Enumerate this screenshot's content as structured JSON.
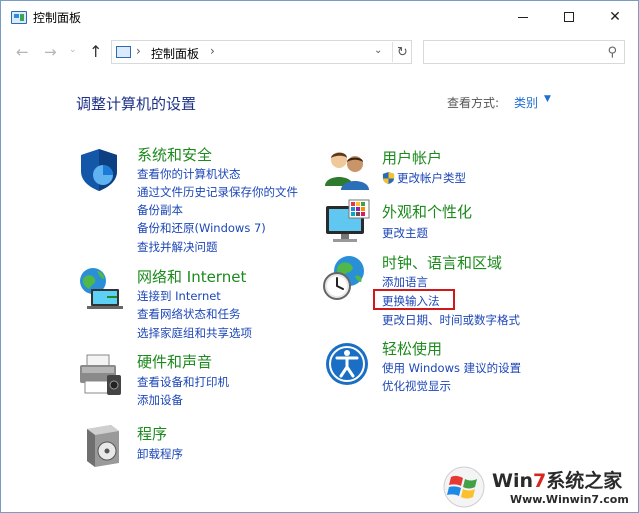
{
  "window": {
    "title": "控制面板",
    "minimize_icon": "minimize-icon",
    "maximize_icon": "maximize-icon",
    "close_glyph": "✕"
  },
  "nav": {
    "back_glyph": "←",
    "forward_glyph": "→",
    "recent_glyph": "⌄",
    "up_glyph": "↑",
    "address_sep": "›",
    "address_text": "控制面板",
    "address_sep2": "›",
    "address_dropdown": "⌄",
    "refresh_glyph": "↻",
    "search_placeholder": "",
    "search_glyph": "⚲"
  },
  "header": {
    "title": "调整计算机的设置",
    "view_label": "查看方式:",
    "view_value": "类别",
    "view_caret": "▼"
  },
  "categories": {
    "system": {
      "title": "系统和安全",
      "links": [
        "查看你的计算机状态",
        "通过文件历史记录保存你的文件",
        "备份副本",
        "备份和还原(Windows 7)",
        "查找并解决问题"
      ]
    },
    "network": {
      "title": "网络和 Internet",
      "links": [
        "连接到 Internet",
        "查看网络状态和任务",
        "选择家庭组和共享选项"
      ]
    },
    "hardware": {
      "title": "硬件和声音",
      "links": [
        "查看设备和打印机",
        "添加设备"
      ]
    },
    "programs": {
      "title": "程序",
      "links": [
        "卸载程序"
      ]
    },
    "users": {
      "title": "用户帐户",
      "links": [
        "更改帐户类型"
      ]
    },
    "appearance": {
      "title": "外观和个性化",
      "links": [
        "更改主题"
      ]
    },
    "clock": {
      "title": "时钟、语言和区域",
      "links": [
        "添加语言",
        "更换输入法",
        "更改日期、时间或数字格式"
      ]
    },
    "ease": {
      "title": "轻松使用",
      "links": [
        "使用 Windows 建议的设置",
        "优化视觉显示"
      ]
    }
  },
  "watermark": {
    "brand_prefix": "Win",
    "brand_seven": "7",
    "brand_suffix": "系统之家",
    "url": "Www.Winwin7.com"
  },
  "colors": {
    "title_green": "#1c8a1c",
    "link_blue": "#1c47b8",
    "highlight_red": "#d01818"
  }
}
